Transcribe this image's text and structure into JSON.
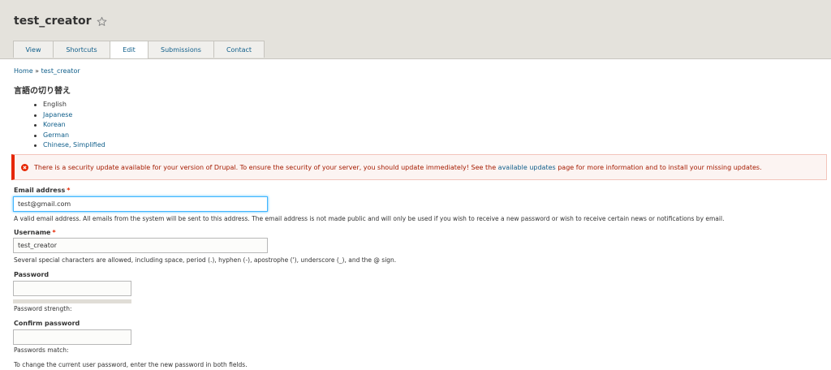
{
  "header": {
    "title": "test_creator",
    "tabs": [
      {
        "label": "View",
        "active": false
      },
      {
        "label": "Shortcuts",
        "active": false
      },
      {
        "label": "Edit",
        "active": true
      },
      {
        "label": "Submissions",
        "active": false
      },
      {
        "label": "Contact",
        "active": false
      }
    ]
  },
  "breadcrumb": {
    "home": "Home",
    "separator": " » ",
    "current": "test_creator"
  },
  "language_switcher": {
    "heading": "言語の切り替え",
    "languages": [
      "English",
      "Japanese",
      "Korean",
      "German",
      "Chinese, Simplified"
    ]
  },
  "alert": {
    "text_before": "There is a security update available for your version of Drupal. To ensure the security of your server, you should update immediately! See the ",
    "link": "available updates",
    "text_after": " page for more information and to install your missing updates."
  },
  "form": {
    "email": {
      "label": "Email address",
      "required_mark": "*",
      "value": "test@gmail.com",
      "description": "A valid email address. All emails from the system will be sent to this address. The email address is not made public and will only be used if you wish to receive a new password or wish to receive certain news or notifications by email."
    },
    "username": {
      "label": "Username",
      "required_mark": "*",
      "value": "test_creator",
      "description": "Several special characters are allowed, including space, period (.), hyphen (-), apostrophe ('), underscore (_), and the @ sign."
    },
    "password": {
      "label": "Password",
      "strength_label": "Password strength:"
    },
    "confirm_password": {
      "label": "Confirm password",
      "match_label": "Passwords match:"
    },
    "password_help": "To change the current user password, enter the new password in both fields."
  },
  "colors": {
    "accent_link": "#0f5e8a",
    "error": "#e62600",
    "focus": "#40b6ff"
  }
}
